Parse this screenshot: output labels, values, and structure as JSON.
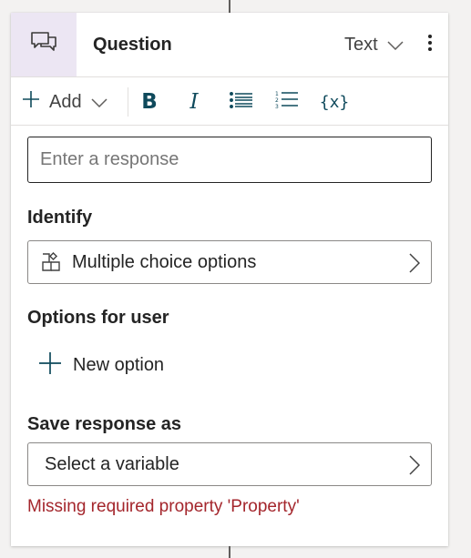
{
  "node": {
    "icon": "chat-bubbles-icon",
    "title": "Question",
    "type_value": "Text",
    "accent_bg": "#ece6f3"
  },
  "toolbar": {
    "add_label": "Add",
    "bold_label": "B",
    "italic_label": "I",
    "variable_label": "{x}",
    "icon_color": "#0f4a5c"
  },
  "response": {
    "value": "",
    "placeholder": "Enter a response"
  },
  "identify": {
    "label": "Identify",
    "value": "Multiple choice options",
    "icon": "entity-shapes-icon"
  },
  "options": {
    "label": "Options for user",
    "new_option_label": "New option"
  },
  "save_response": {
    "label": "Save response as",
    "value": "Select a variable"
  },
  "error": {
    "message": "Missing required property 'Property'",
    "color": "#a4262c"
  }
}
